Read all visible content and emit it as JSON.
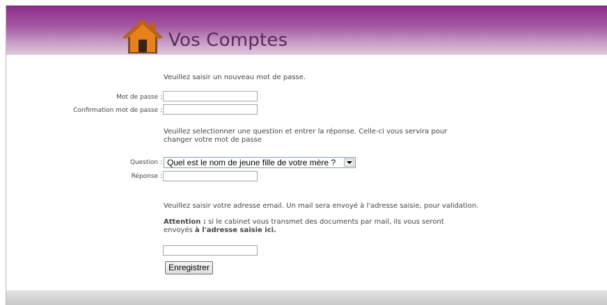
{
  "header": {
    "title": "Vos Comptes"
  },
  "intro_text": "Veuillez saisir un nouveau mot de passe.",
  "password": {
    "label": "Mot de passe :",
    "value": ""
  },
  "confirm": {
    "label": "Confirmation mot de passe :",
    "value": ""
  },
  "question_intro": {
    "line1": "Veuillez selectionner une question et entrer la réponse. Celle-ci vous servira pour",
    "line2": "changer votre mot de passe"
  },
  "question": {
    "label": "Question :",
    "selected": "Quel est le nom de jeune fille de votre mère ?"
  },
  "answer": {
    "label": "Réponse :",
    "value": ""
  },
  "email_text": "Veuillez saisir votre adresse email. Un mail sera envoyé à l'adresse saisie, pour validation.",
  "attention": {
    "label": "Attention :",
    "line1": " si le cabinet vous transmet des documents par mail, ils vous seront",
    "line2_prefix": "envoyés ",
    "line2_bold": "à l'adresse saisie ici."
  },
  "email": {
    "value": ""
  },
  "submit_label": "Enregistrer",
  "colors": {
    "header": "#a356a0",
    "title": "#5a2a5c",
    "house_roof": "#e07a1c"
  },
  "icons": {
    "logo": "house-icon"
  }
}
